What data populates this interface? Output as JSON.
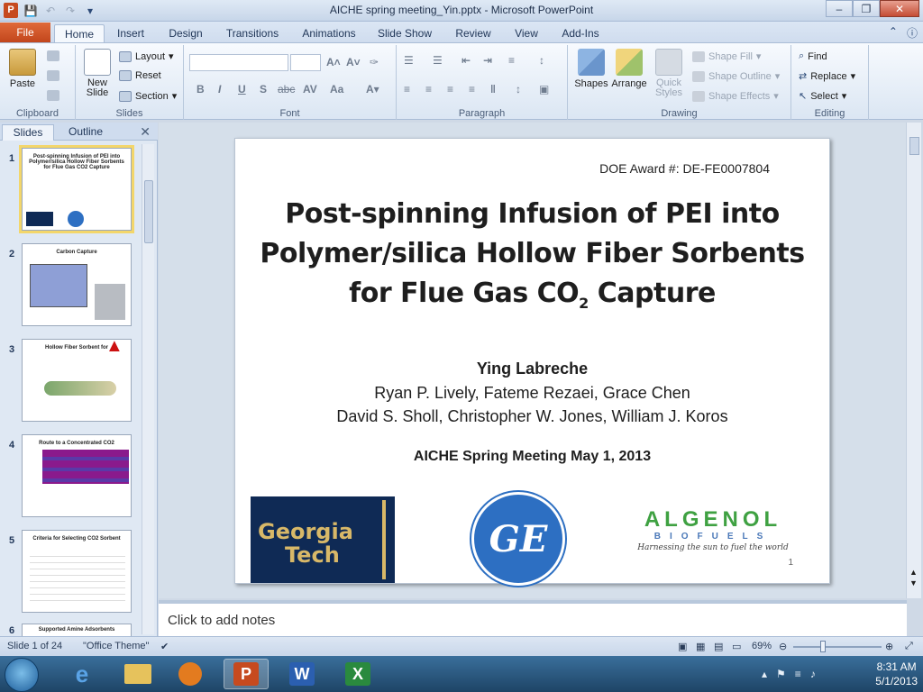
{
  "window": {
    "title": "AICHE spring meeting_Yin.pptx - Microsoft PowerPoint",
    "app_icon": "P",
    "qat": [
      "save-icon",
      "undo-icon",
      "redo-icon",
      "customize-icon"
    ]
  },
  "tabs": {
    "file": "File",
    "items": [
      "Home",
      "Insert",
      "Design",
      "Transitions",
      "Animations",
      "Slide Show",
      "Review",
      "View",
      "Add-Ins"
    ],
    "active": "Home"
  },
  "ribbon": {
    "clipboard": {
      "label": "Clipboard",
      "paste": "Paste"
    },
    "slides": {
      "label": "Slides",
      "new_slide_1": "New",
      "new_slide_2": "Slide",
      "layout": "Layout",
      "reset": "Reset",
      "section": "Section"
    },
    "font": {
      "label": "Font",
      "bold": "B",
      "italic": "I",
      "underline": "U",
      "shadow": "S",
      "strike": "abc",
      "spacing": "AV",
      "case": "Aa"
    },
    "paragraph": {
      "label": "Paragraph"
    },
    "drawing": {
      "label": "Drawing",
      "shapes": "Shapes",
      "arrange": "Arrange",
      "quick_styles_1": "Quick",
      "quick_styles_2": "Styles",
      "shape_fill": "Shape Fill",
      "shape_outline": "Shape Outline",
      "shape_effects": "Shape Effects"
    },
    "editing": {
      "label": "Editing",
      "find": "Find",
      "replace": "Replace",
      "select": "Select"
    }
  },
  "pane": {
    "tab_slides": "Slides",
    "tab_outline": "Outline",
    "thumbnails": [
      {
        "num": "1",
        "title": "Post-spinning Infusion of PEI into Polymer/silica Hollow Fiber Sorbents for Flue Gas CO2 Capture"
      },
      {
        "num": "2",
        "title": "Carbon Capture"
      },
      {
        "num": "3",
        "title": "Hollow Fiber Sorbent for"
      },
      {
        "num": "4",
        "title": "Route to a Concentrated CO2"
      },
      {
        "num": "5",
        "title": "Criteria for Selecting CO2 Sorbent"
      },
      {
        "num": "6",
        "title": "Supported Amine Adsorbents"
      }
    ]
  },
  "slide": {
    "award": "DOE Award #: DE-FE0007804",
    "title_line1": "Post-spinning Infusion of PEI into",
    "title_line2": "Polymer/silica Hollow Fiber Sorbents",
    "title_line3a": "for Flue Gas CO",
    "title_line3sub": "2",
    "title_line3b": " Capture",
    "presenter": "Ying Labreche",
    "authors_line1": "Ryan P. Lively, Fateme Rezaei, Grace Chen",
    "authors_line2": "David S. Sholl, Christopher W. Jones, William J. Koros",
    "meeting": "AICHE Spring Meeting May 1, 2013",
    "gt_line1": "Georgia",
    "gt_line2": "Tech",
    "ge_symbol": "GE",
    "algenol": "ALGENOL",
    "algenol_sub": "BIOFUELS",
    "algenol_tagline": "Harnessing the sun to fuel the world",
    "page_num": "1"
  },
  "notes": {
    "placeholder": "Click to add notes"
  },
  "status": {
    "slide_info": "Slide 1 of 24",
    "theme": "\"Office Theme\"",
    "zoom": "69%"
  },
  "taskbar": {
    "time": "8:31 AM",
    "date": "5/1/2013"
  },
  "colors": {
    "file_tab": "#c2461c",
    "title_bar": "#c7d6e9",
    "taskbar": "#1e4466"
  }
}
